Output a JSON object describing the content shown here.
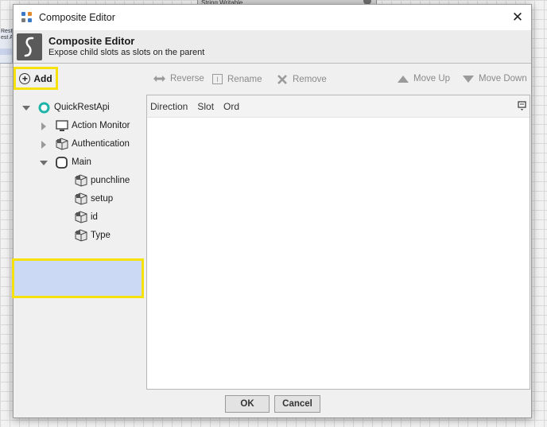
{
  "background": {
    "node_label": "String Writable",
    "fragment_text": "RestA\nest A"
  },
  "window": {
    "title": "Composite Editor",
    "close_glyph": "✕"
  },
  "header": {
    "title": "Composite Editor",
    "subtitle": "Expose child slots as slots on the parent"
  },
  "toolbar": {
    "add": "Add",
    "reverse": "Reverse",
    "rename": "Rename",
    "remove": "Remove",
    "move_up": "Move Up",
    "move_down": "Move Down"
  },
  "tree": {
    "root": "QuickRestApi",
    "items": [
      {
        "label": "Action Monitor"
      },
      {
        "label": "Authentication"
      },
      {
        "label": "Main"
      },
      {
        "label": "punchline"
      },
      {
        "label": "setup"
      },
      {
        "label": "id"
      },
      {
        "label": "Type"
      }
    ]
  },
  "table": {
    "columns": [
      "Direction",
      "Slot",
      "Ord"
    ]
  },
  "footer": {
    "ok": "OK",
    "cancel": "Cancel"
  },
  "colors": {
    "highlight": "#f5e20c",
    "selection": "#cbd9f5",
    "root_icon": "#20b3a8"
  }
}
